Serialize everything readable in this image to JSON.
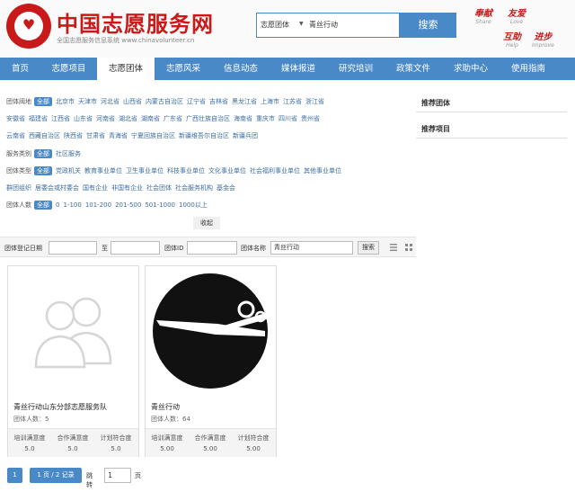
{
  "header": {
    "site_title": "中国志愿服务网",
    "site_subtitle": "全国志愿服务信息系统 www.chinavolunteer.cn",
    "logo_text": "中国志愿服务",
    "search": {
      "type": "志愿团体",
      "query": "青丝行动",
      "button": "搜索"
    },
    "slogans": [
      {
        "cn": "奉献",
        "en": "Share"
      },
      {
        "cn": "友爱",
        "en": "Love"
      },
      {
        "cn": "互助",
        "en": "Help"
      },
      {
        "cn": "进步",
        "en": "Improve"
      }
    ]
  },
  "nav": [
    "首页",
    "志愿项目",
    "志愿团体",
    "志愿风采",
    "信息动态",
    "媒体报道",
    "研究培训",
    "政策文件",
    "求助中心",
    "使用指南"
  ],
  "nav_active": "志愿团体",
  "filters": {
    "area_label": "团体阈地",
    "all": "全部",
    "areas_row1": [
      "北京市",
      "天津市",
      "河北省",
      "山西省",
      "内蒙古自治区",
      "辽宁省",
      "吉林省",
      "黑龙江省",
      "上海市",
      "江苏省",
      "浙江省"
    ],
    "areas_row2": [
      "安徽省",
      "福建省",
      "江西省",
      "山东省",
      "河南省",
      "湖北省",
      "湖南省",
      "广东省",
      "广西壮族自治区",
      "海南省",
      "重庆市",
      "四川省",
      "贵州省"
    ],
    "areas_row3": [
      "云南省",
      "西藏自治区",
      "陕西省",
      "甘肃省",
      "青海省",
      "宁夏回族自治区",
      "新疆维吾尔自治区",
      "新疆兵团"
    ],
    "category_label": "服务类别",
    "categories": [
      "社区服务"
    ],
    "type_label": "团体类型",
    "types_row1": [
      "党政机关",
      "教育事业单位",
      "卫生事业单位",
      "科技事业单位",
      "文化事业单位",
      "社会福利事业单位",
      "其他事业单位"
    ],
    "types_row2": [
      "群团组织",
      "居委会或村委会",
      "国有企业",
      "非国有企业",
      "社会团体",
      "社会服务机构",
      "基金会"
    ],
    "size_label": "团体人数",
    "sizes": [
      "0",
      "1-100",
      "101-200",
      "201-500",
      "501-1000",
      "1000以上"
    ],
    "collapse": "收起"
  },
  "query_bar": {
    "date_label": "团体登记日期",
    "to_label": "至",
    "id_label": "团体ID",
    "name_label": "团体名称",
    "name_value": "青丝行动",
    "search_button": "搜索"
  },
  "sidebar": {
    "recommended_teams": "推荐团体",
    "recommended_projects": "推荐项目"
  },
  "cards": [
    {
      "name": "青丝行动山东分部志愿服务队",
      "members": "团体人数：5",
      "stats": [
        {
          "label": "培训满意度",
          "value": "5.0"
        },
        {
          "label": "合作满意度",
          "value": "5.0"
        },
        {
          "label": "计划符合度",
          "value": "5.0"
        }
      ]
    },
    {
      "name": "青丝行动",
      "members": "团体人数：64",
      "stats": [
        {
          "label": "培训满意度",
          "value": "5.00"
        },
        {
          "label": "合作满意度",
          "value": "5.00"
        },
        {
          "label": "计划符合度",
          "value": "5.00"
        }
      ]
    }
  ],
  "pager": {
    "current": "1",
    "info": "1 页 / 2 记录",
    "jump_label": "跳转",
    "jump_value": "1",
    "page_suffix": "页"
  },
  "colors": {
    "brand_red": "#c91a1a",
    "primary_blue": "#4a89c8"
  }
}
